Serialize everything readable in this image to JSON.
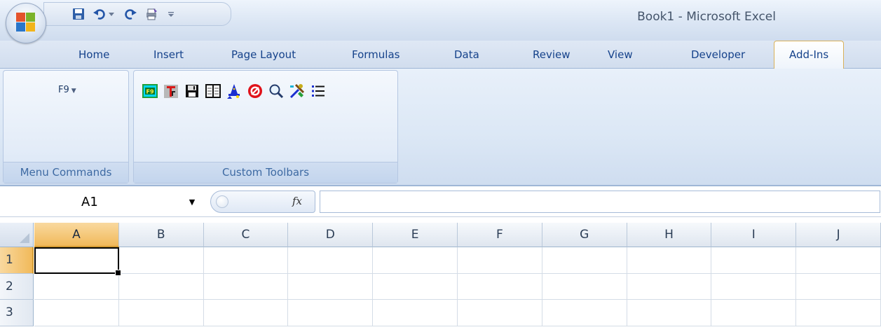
{
  "window": {
    "title": "Book1 - Microsoft Excel"
  },
  "quick_access": [
    {
      "name": "save-icon"
    },
    {
      "name": "undo-icon"
    },
    {
      "name": "undo-dropdown-icon"
    },
    {
      "name": "redo-icon"
    },
    {
      "name": "quick-print-icon"
    },
    {
      "name": "customize-qat-icon"
    }
  ],
  "tabs": [
    {
      "label": "Home"
    },
    {
      "label": "Insert"
    },
    {
      "label": "Page Layout"
    },
    {
      "label": "Formulas"
    },
    {
      "label": "Data"
    },
    {
      "label": "Review"
    },
    {
      "label": "View"
    },
    {
      "label": "Developer"
    },
    {
      "label": "Add-Ins",
      "active": true
    }
  ],
  "ribbon": {
    "menu_commands": {
      "button_label": "F9",
      "group_label": "Menu Commands"
    },
    "custom_toolbars": {
      "group_label": "Custom Toolbars",
      "icons": [
        "f9-calc-icon",
        "text-format-icon",
        "save-disk-icon",
        "columns-icon",
        "wizard-icon",
        "stop-icon",
        "magnify-icon",
        "tools-icon",
        "list-icon"
      ]
    }
  },
  "formula_bar": {
    "name_box": "A1",
    "fx_label": "fx",
    "value": ""
  },
  "grid": {
    "columns": [
      "A",
      "B",
      "C",
      "D",
      "E",
      "F",
      "G",
      "H",
      "I",
      "J"
    ],
    "rows": [
      "1",
      "2",
      "3"
    ],
    "active_cell": "A1"
  },
  "colors": {
    "ribbon_text": "#15428b",
    "selected_header": "#f1b95a",
    "active_tab_border": "#d9b15a"
  }
}
